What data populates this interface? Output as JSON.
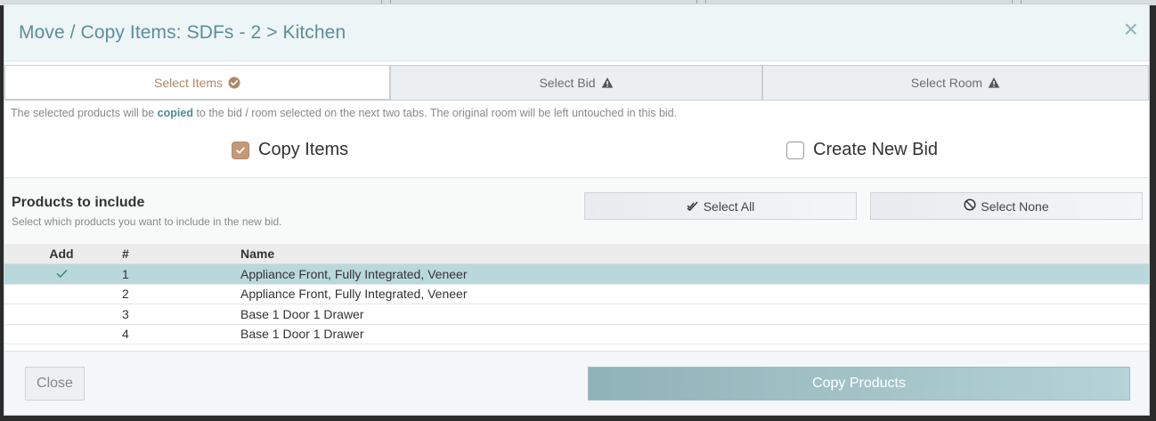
{
  "modal": {
    "title": "Move / Copy Items: SDFs - 2 > Kitchen",
    "close_glyph": "×"
  },
  "tabs": [
    {
      "label": "Select Items",
      "icon": "check-circle-icon",
      "active": true
    },
    {
      "label": "Select Bid",
      "icon": "warning-icon",
      "active": false
    },
    {
      "label": "Select Room",
      "icon": "warning-icon",
      "active": false
    }
  ],
  "info": {
    "prefix": "The selected products will be ",
    "emphasis": "copied",
    "suffix": " to the bid / room selected on the next two tabs. The original room will be left untouched in this bid."
  },
  "options": {
    "copy_items": {
      "label": "Copy Items",
      "checked": true
    },
    "create_new_bid": {
      "label": "Create New Bid",
      "checked": false
    }
  },
  "products": {
    "title": "Products to include",
    "subtitle": "Select which products you want to include in the new bid.",
    "select_all_label": "Select All",
    "select_none_label": "Select None"
  },
  "table": {
    "headers": {
      "add": "Add",
      "num": "#",
      "name": "Name"
    },
    "rows": [
      {
        "num": "1",
        "name": "Appliance Front, Fully Integrated, Veneer",
        "selected": true
      },
      {
        "num": "2",
        "name": "Appliance Front, Fully Integrated, Veneer",
        "selected": false
      },
      {
        "num": "3",
        "name": "Base 1 Door 1 Drawer",
        "selected": false
      },
      {
        "num": "4",
        "name": "Base 1 Door 1 Drawer",
        "selected": false
      }
    ]
  },
  "footer": {
    "close_label": "Close",
    "copy_label": "Copy Products"
  },
  "colors": {
    "accent": "#5b8f99",
    "tab_active": "#b08868",
    "checkbox": "#c29a78",
    "row_selected": "#b9d8dc",
    "primary_button": "#8fb2b8"
  }
}
